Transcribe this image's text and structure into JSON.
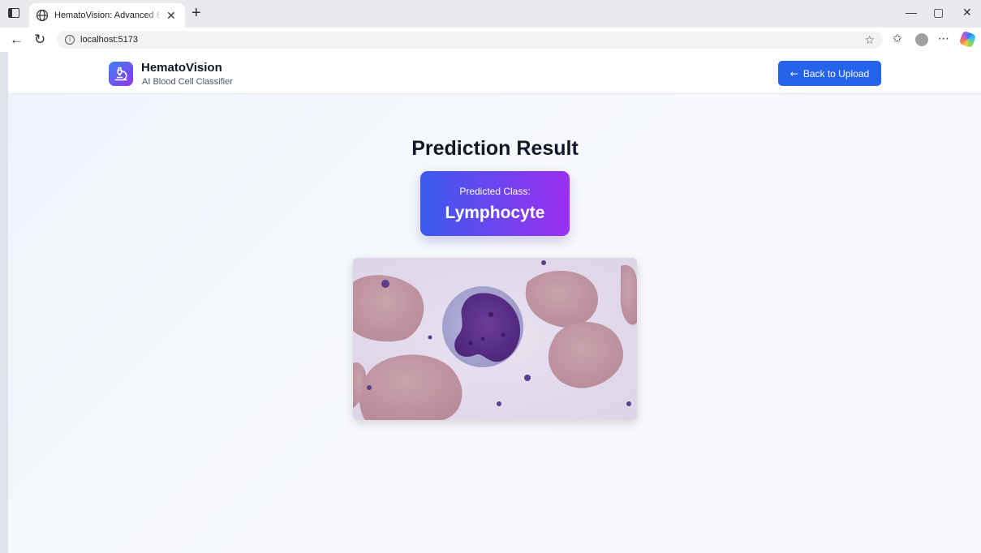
{
  "browser": {
    "tab_title": "HematoVision: Advanced Blood C",
    "url": "localhost:5173"
  },
  "header": {
    "brand_name": "HematoVision",
    "brand_subtitle": "AI Blood Cell Classifier",
    "back_button": "Back to Upload"
  },
  "result": {
    "title": "Prediction Result",
    "label": "Predicted Class:",
    "predicted_class": "Lymphocyte"
  },
  "colors": {
    "primary": "#2563eb",
    "gradient_start": "#3b5bf0",
    "gradient_end": "#9b2ff0",
    "text_dark": "#111827"
  },
  "icons": {
    "logo": "microscope-icon",
    "back": "arrow-left-icon",
    "tab": "globe-icon"
  }
}
